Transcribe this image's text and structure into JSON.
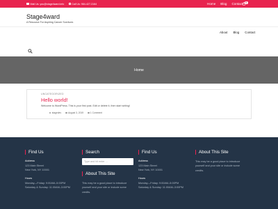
{
  "topbar": {
    "email": "Mail Us: you@stage4ward.info",
    "phone": "Call Us: 984-427-3164",
    "nav": [
      "Home",
      "Blog",
      "Contact"
    ],
    "cart_count": "0"
  },
  "header": {
    "title": "Stage4ward",
    "tagline": "A Resource For Aspiring Cancer Survivors",
    "nav": [
      "About",
      "Blog",
      "Contact"
    ]
  },
  "hero": {
    "title": "Home"
  },
  "post": {
    "category": "UNCATEGORIZED",
    "title": "Hello world!",
    "excerpt": "Welcome to WordPress. This is your first post. Edit or delete it, then start writing!",
    "author": "stagedev",
    "date": "August 3, 2019",
    "comments": "1 Comment"
  },
  "footer": {
    "find_us_left": {
      "heading": "Find Us",
      "address_label": "Address",
      "address_line1": "123 Main Street",
      "address_line2": "New York, NY 10001",
      "hours_label": "Hours",
      "hours_line1": "Monday—Friday: 9:00AM–5:00PM",
      "hours_line2": "Saturday & Sunday: 11:00AM–3:00PM"
    },
    "search": {
      "heading": "Search",
      "placeholder": "Type and hit enter ..."
    },
    "about_mid": {
      "heading": "About This Site",
      "text_line1": "This may be a good place to introduce",
      "text_line2": "yourself and your site or include some",
      "text_line3": "credits."
    },
    "find_us_right": {
      "heading": "Find Us",
      "address_label": "Address",
      "address_line1": "123 Main Street",
      "address_line2": "New York, NY 10001",
      "hours_label": "Hours",
      "hours_line1": "Monday—Friday: 9:00AM–5:00PM",
      "hours_line2": "Saturday & Sunday: 11:00AM–3:00PM"
    },
    "about_right": {
      "heading": "About This Site",
      "text_line1": "This may be a good place to introduce",
      "text_line2": "yourself and your site or include some",
      "text_line3": "credits."
    }
  },
  "colors": {
    "accent": "#e8234f",
    "hero_bg": "#656565",
    "footer_bg": "#243447"
  },
  "icons": [
    "mail-icon",
    "phone-icon",
    "cart-icon",
    "search-icon",
    "user-icon",
    "calendar-icon",
    "comment-icon"
  ]
}
